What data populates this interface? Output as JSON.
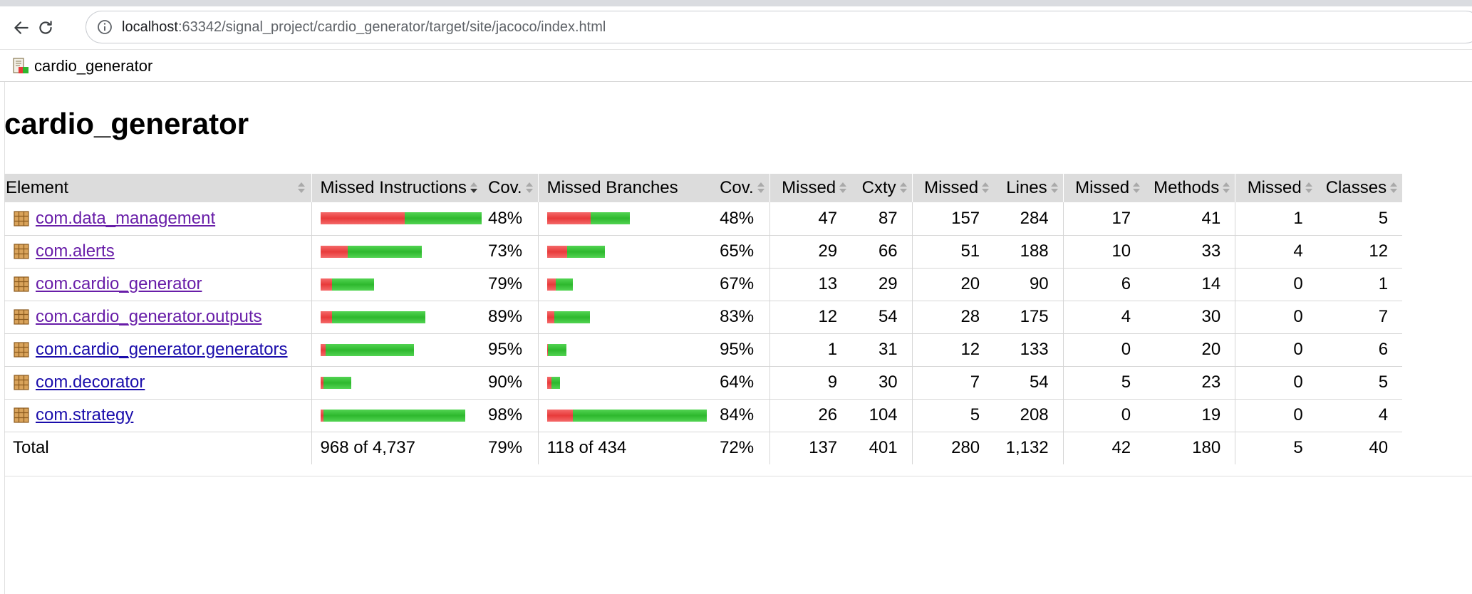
{
  "browser": {
    "url_host": "localhost",
    "url_path": ":63342/signal_project/cardio_generator/target/site/jacoco/index.html",
    "back_icon": "arrow-left-icon",
    "reload_icon": "reload-icon",
    "info_icon": "info-icon"
  },
  "breadcrumb": {
    "label": "cardio_generator",
    "icon": "report-icon"
  },
  "page": {
    "title": "cardio_generator"
  },
  "table": {
    "headers": [
      "Element",
      "Missed Instructions",
      "Cov.",
      "Missed Branches",
      "Cov.",
      "Missed",
      "Cxty",
      "Missed",
      "Lines",
      "Missed",
      "Methods",
      "Missed",
      "Classes"
    ],
    "rows": [
      {
        "name": "com.data_management",
        "visited": true,
        "instr_missed_ratio": 0.52,
        "instr_bar_fill": 1.0,
        "instr_cov": "48%",
        "br_missed_ratio": 0.52,
        "br_bar_fill": 0.52,
        "br_cov": "48%",
        "missed_cxty": "47",
        "cxty": "87",
        "missed_lines": "157",
        "lines": "284",
        "missed_methods": "17",
        "methods": "41",
        "missed_classes": "1",
        "classes": "5"
      },
      {
        "name": "com.alerts",
        "visited": true,
        "instr_missed_ratio": 0.27,
        "instr_bar_fill": 0.63,
        "instr_cov": "73%",
        "br_missed_ratio": 0.35,
        "br_bar_fill": 0.36,
        "br_cov": "65%",
        "missed_cxty": "29",
        "cxty": "66",
        "missed_lines": "51",
        "lines": "188",
        "missed_methods": "10",
        "methods": "33",
        "missed_classes": "4",
        "classes": "12"
      },
      {
        "name": "com.cardio_generator",
        "visited": true,
        "instr_missed_ratio": 0.21,
        "instr_bar_fill": 0.33,
        "instr_cov": "79%",
        "br_missed_ratio": 0.33,
        "br_bar_fill": 0.16,
        "br_cov": "67%",
        "missed_cxty": "13",
        "cxty": "29",
        "missed_lines": "20",
        "lines": "90",
        "missed_methods": "6",
        "methods": "14",
        "missed_classes": "0",
        "classes": "1"
      },
      {
        "name": "com.cardio_generator.outputs",
        "visited": true,
        "instr_missed_ratio": 0.11,
        "instr_bar_fill": 0.65,
        "instr_cov": "89%",
        "br_missed_ratio": 0.17,
        "br_bar_fill": 0.27,
        "br_cov": "83%",
        "missed_cxty": "12",
        "cxty": "54",
        "missed_lines": "28",
        "lines": "175",
        "missed_methods": "4",
        "methods": "30",
        "missed_classes": "0",
        "classes": "7"
      },
      {
        "name": "com.cardio_generator.generators",
        "visited": false,
        "instr_missed_ratio": 0.05,
        "instr_bar_fill": 0.58,
        "instr_cov": "95%",
        "br_missed_ratio": 0.05,
        "br_bar_fill": 0.12,
        "br_cov": "95%",
        "missed_cxty": "1",
        "cxty": "31",
        "missed_lines": "12",
        "lines": "133",
        "missed_methods": "0",
        "methods": "20",
        "missed_classes": "0",
        "classes": "6"
      },
      {
        "name": "com.decorator",
        "visited": false,
        "instr_missed_ratio": 0.1,
        "instr_bar_fill": 0.19,
        "instr_cov": "90%",
        "br_missed_ratio": 0.36,
        "br_bar_fill": 0.08,
        "br_cov": "64%",
        "missed_cxty": "9",
        "cxty": "30",
        "missed_lines": "7",
        "lines": "54",
        "missed_methods": "5",
        "methods": "23",
        "missed_classes": "0",
        "classes": "5"
      },
      {
        "name": "com.strategy",
        "visited": false,
        "instr_missed_ratio": 0.02,
        "instr_bar_fill": 0.9,
        "instr_cov": "98%",
        "br_missed_ratio": 0.16,
        "br_bar_fill": 1.0,
        "br_cov": "84%",
        "missed_cxty": "26",
        "cxty": "104",
        "missed_lines": "5",
        "lines": "208",
        "missed_methods": "0",
        "methods": "19",
        "missed_classes": "0",
        "classes": "4"
      }
    ],
    "total": {
      "label": "Total",
      "instr": "968 of 4,737",
      "instr_cov": "79%",
      "br": "118 of 434",
      "br_cov": "72%",
      "missed_cxty": "137",
      "cxty": "401",
      "missed_lines": "280",
      "lines": "1,132",
      "missed_methods": "42",
      "methods": "180",
      "missed_classes": "5",
      "classes": "40"
    }
  },
  "colors": {
    "missed": "#e83a3a",
    "covered": "#2eb82e",
    "header_bg": "#dcdcdc",
    "link": "#1a0dab",
    "visited_link": "#681da8"
  }
}
